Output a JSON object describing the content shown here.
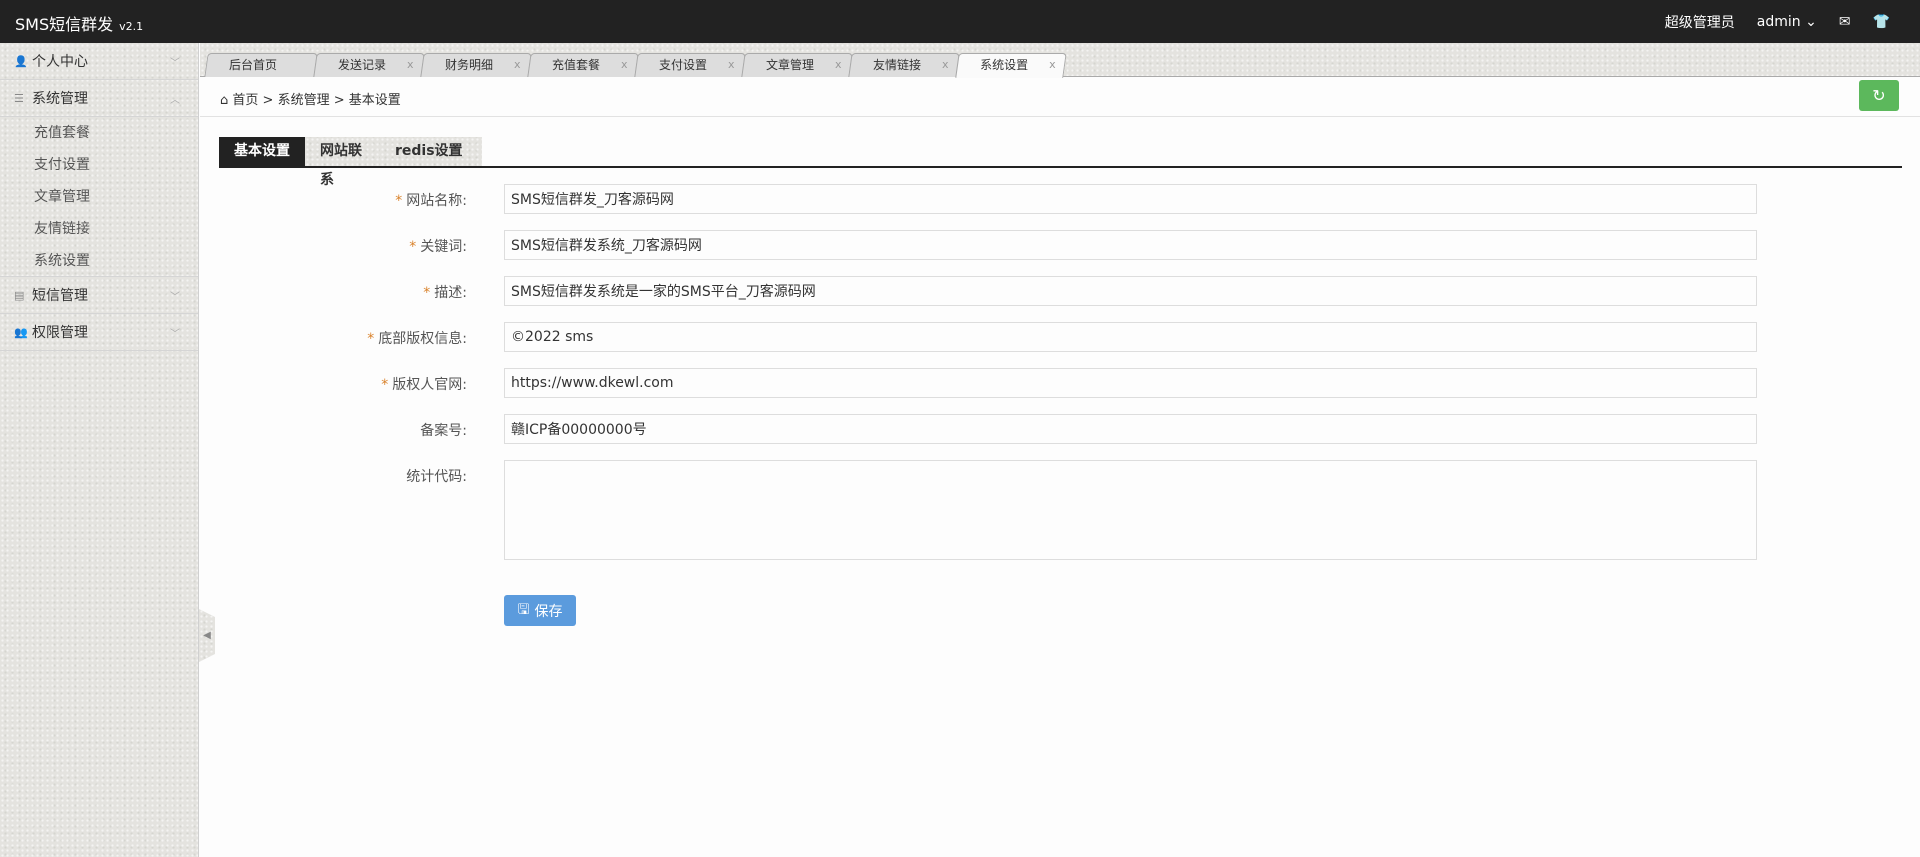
{
  "header": {
    "app_name": "SMS短信群发",
    "version": "v2.1",
    "role": "超级管理员",
    "user": "admin"
  },
  "sidebar": {
    "groups": [
      {
        "label": "个人中心",
        "icon": "user-icon"
      },
      {
        "label": "系统管理",
        "icon": "database-icon",
        "items": [
          "充值套餐",
          "支付设置",
          "文章管理",
          "友情链接",
          "系统设置"
        ]
      },
      {
        "label": "短信管理",
        "icon": "book-icon"
      },
      {
        "label": "权限管理",
        "icon": "users-icon"
      }
    ]
  },
  "tabs": [
    "后台首页",
    "发送记录",
    "财务明细",
    "充值套餐",
    "支付设置",
    "文章管理",
    "友情链接",
    "系统设置"
  ],
  "breadcrumb": [
    "首页",
    "系统管理",
    "基本设置"
  ],
  "inner_tabs": [
    "基本设置",
    "网站联系",
    "redis设置"
  ],
  "form": {
    "fields": [
      {
        "label": "网站名称:",
        "required": true,
        "value": "SMS短信群发_刀客源码网"
      },
      {
        "label": "关键词:",
        "required": true,
        "value": "SMS短信群发系统_刀客源码网"
      },
      {
        "label": "描述:",
        "required": true,
        "value": "SMS短信群发系统是一家的SMS平台_刀客源码网"
      },
      {
        "label": "底部版权信息:",
        "required": true,
        "value": "©2022 sms"
      },
      {
        "label": "版权人官网:",
        "required": true,
        "value": "https://www.dkewl.com"
      },
      {
        "label": "备案号:",
        "required": false,
        "value": "赣ICP备00000000号"
      },
      {
        "label": "统计代码:",
        "required": false,
        "value": ""
      }
    ],
    "save_label": "保存"
  }
}
